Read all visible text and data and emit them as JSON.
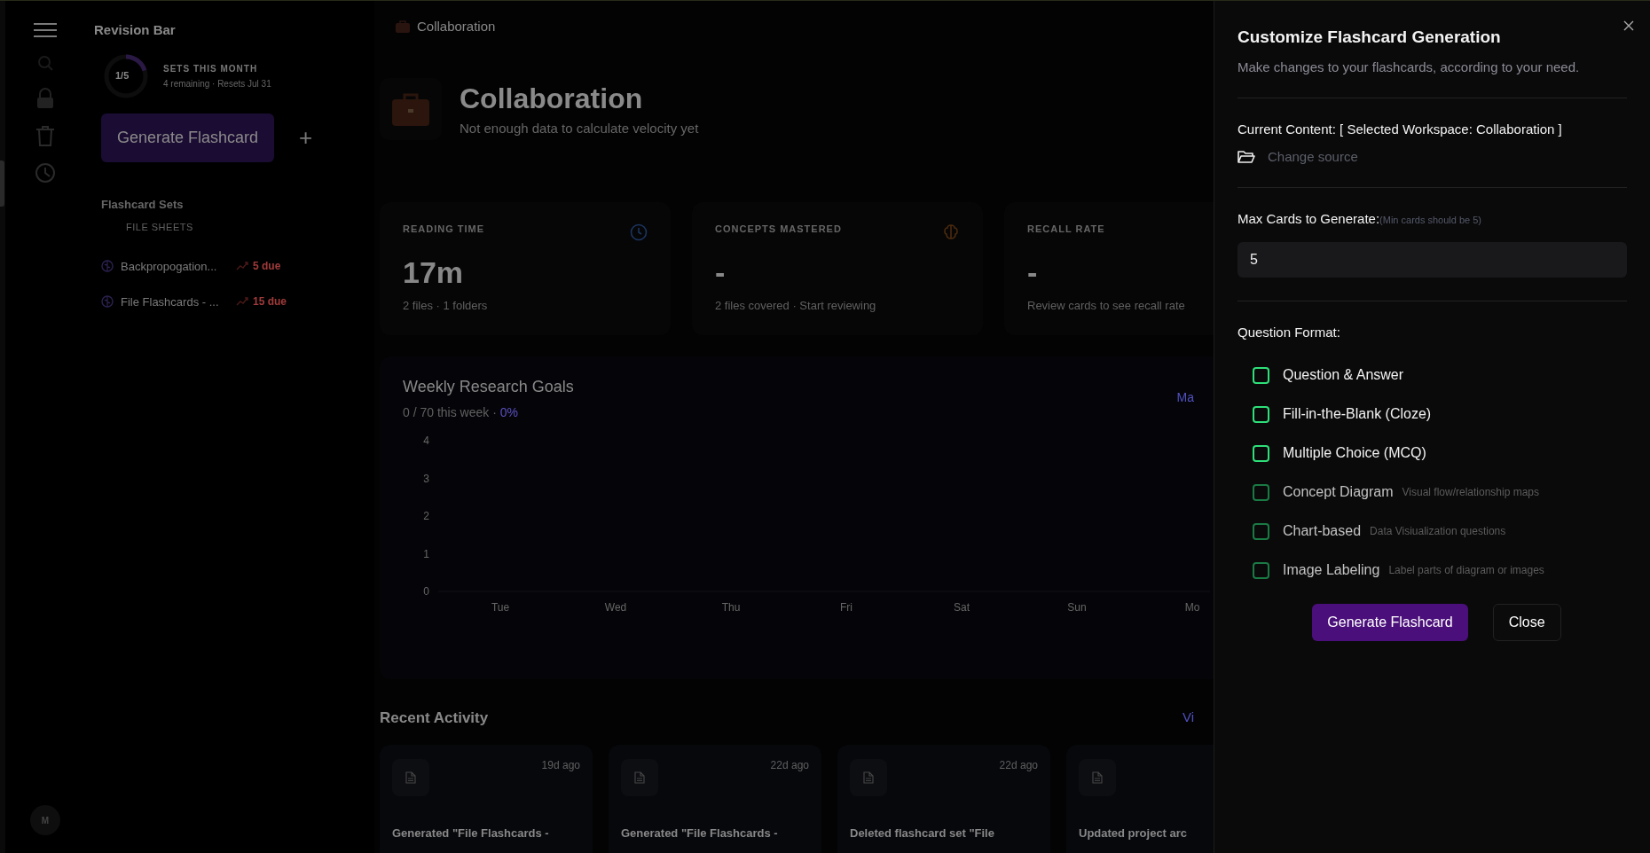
{
  "rail": {
    "avatar": "M"
  },
  "sidebar": {
    "title": "Revision Bar",
    "usage": {
      "count": "1/5",
      "label": "SETS THIS MONTH",
      "detail": "4 remaining · Resets Jul 31"
    },
    "generate_button": "Generate Flashcard",
    "add_button": "+",
    "sets_heading": "Flashcard Sets",
    "group_label": "FILE SHEETS",
    "sets": [
      {
        "name": "Backpropogation...",
        "due": "5 due"
      },
      {
        "name": "File Flashcards - ...",
        "due": "15 due"
      }
    ]
  },
  "breadcrumb": "Collaboration",
  "header": {
    "title": "Collaboration",
    "subtitle": "Not enough data to calculate velocity yet"
  },
  "stats": [
    {
      "label": "READING TIME",
      "value": "17m",
      "detail": "2 files · 1 folders"
    },
    {
      "label": "CONCEPTS MASTERED",
      "value": "-",
      "detail": "2 files covered · Start reviewing"
    },
    {
      "label": "RECALL RATE",
      "value": "-",
      "detail": "Review cards to see recall rate"
    }
  ],
  "goals": {
    "title": "Weekly Research Goals",
    "progress": "0 / 70 this week ·",
    "percent": "0%",
    "link": "Ma",
    "chart_data": {
      "type": "bar",
      "categories": [
        "Tue",
        "Wed",
        "Thu",
        "Fri",
        "Sat",
        "Sun",
        "Mo"
      ],
      "ylim": [
        0,
        4
      ],
      "yticks": [
        0,
        1,
        2,
        3,
        4
      ],
      "series": [
        {
          "values": [
            null,
            null,
            null,
            null,
            null,
            null,
            null
          ]
        }
      ]
    }
  },
  "activity": {
    "title": "Recent Activity",
    "link": "Vi",
    "items": [
      {
        "time": "19d ago",
        "title": "Generated \"File Flashcards -"
      },
      {
        "time": "22d ago",
        "title": "Generated \"File Flashcards -"
      },
      {
        "time": "22d ago",
        "title": "Deleted flashcard set \"File"
      },
      {
        "title": "Updated project arc"
      }
    ]
  },
  "dialog": {
    "title": "Customize Flashcard Generation",
    "subtitle": "Make changes to your flashcards, according to your need.",
    "current_content": "Current Content: [ Selected Workspace: Collaboration ]",
    "change_source": "Change source",
    "max_cards_label": "Max Cards to Generate:",
    "max_cards_hint": "(Min cards should be 5)",
    "max_cards_value": "5",
    "format_label": "Question Format:",
    "options": [
      {
        "label": "Question & Answer",
        "checked": false,
        "disabled": false
      },
      {
        "label": "Fill-in-the-Blank (Cloze)",
        "checked": false,
        "disabled": false
      },
      {
        "label": "Multiple Choice (MCQ)",
        "checked": false,
        "disabled": false
      },
      {
        "label": "Concept Diagram",
        "description": "Visual flow/relationship maps",
        "checked": false,
        "disabled": true
      },
      {
        "label": "Chart-based",
        "description": "Data Visiualization questions",
        "checked": false,
        "disabled": true
      },
      {
        "label": "Image Labeling",
        "description": "Label parts of diagram or images",
        "checked": false,
        "disabled": true
      }
    ],
    "generate_button": "Generate Flashcard",
    "close_button": "Close"
  }
}
